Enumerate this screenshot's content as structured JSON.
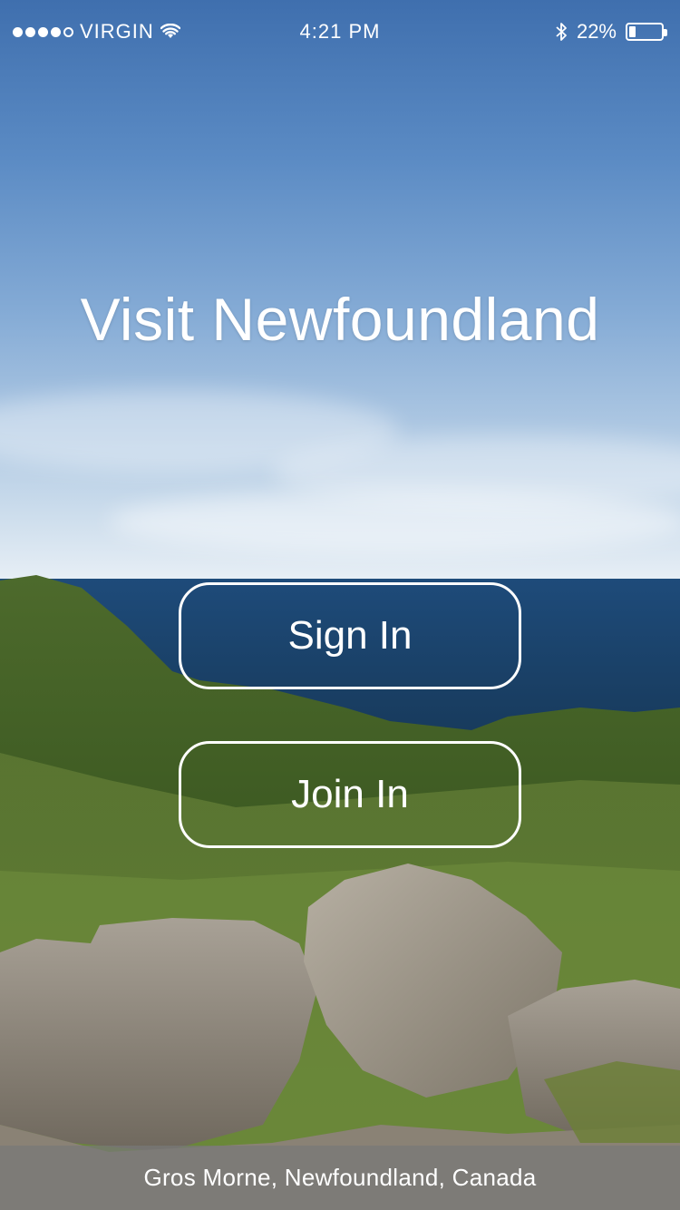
{
  "status_bar": {
    "carrier": "VIRGIN",
    "signal_bars_filled": 4,
    "signal_bars_total": 5,
    "time": "4:21 PM",
    "battery_percent_label": "22%",
    "battery_level": 0.22,
    "icons": [
      "signal-dots",
      "wifi-icon",
      "bluetooth-icon",
      "battery-icon"
    ]
  },
  "hero": {
    "title": "Visit Newfoundland"
  },
  "actions": {
    "sign_in_label": "Sign In",
    "join_in_label": "Join In"
  },
  "photo": {
    "caption": "Gros Morne, Newfoundland, Canada"
  },
  "colors": {
    "text": "#ffffff",
    "button_border": "#ffffff",
    "caption_bar": "#787878"
  }
}
